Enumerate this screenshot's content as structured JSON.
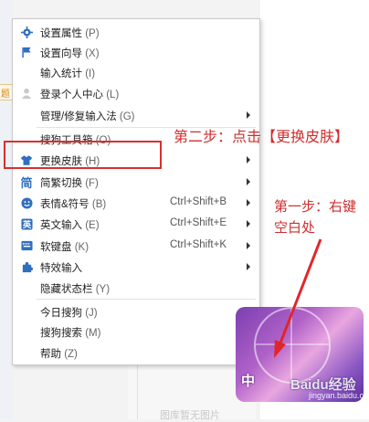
{
  "menu": {
    "items": [
      {
        "icon": "gear-icon",
        "label": "设置属性",
        "key": "(P)",
        "shortcut": "",
        "submenu": false
      },
      {
        "icon": "flag-icon",
        "label": "设置向导",
        "key": "(X)",
        "shortcut": "",
        "submenu": false
      },
      {
        "icon": "",
        "label": "输入统计",
        "key": "(I)",
        "shortcut": "",
        "submenu": false
      },
      {
        "icon": "user-icon",
        "label": "登录个人中心",
        "key": "(L)",
        "shortcut": "",
        "submenu": false
      },
      {
        "icon": "",
        "label": "管理/修复输入法",
        "key": "(G)",
        "shortcut": "",
        "submenu": true
      },
      {
        "icon": "",
        "label": "搜狗工具箱",
        "key": "(O)",
        "shortcut": "",
        "submenu": false
      },
      {
        "icon": "shirt-icon",
        "label": "更换皮肤",
        "key": "(H)",
        "shortcut": "",
        "submenu": true
      },
      {
        "icon": "simplified-icon",
        "label": "简繁切换",
        "key": "(F)",
        "shortcut": "",
        "submenu": true
      },
      {
        "icon": "smiley-icon",
        "label": "表情&符号",
        "key": "(B)",
        "shortcut": "Ctrl+Shift+B",
        "submenu": true
      },
      {
        "icon": "english-icon",
        "label": "英文输入",
        "key": "(E)",
        "shortcut": "Ctrl+Shift+E",
        "submenu": true
      },
      {
        "icon": "keyboard-icon",
        "label": "软键盘",
        "key": "(K)",
        "shortcut": "Ctrl+Shift+K",
        "submenu": true
      },
      {
        "icon": "puzzle-icon",
        "label": "特效输入",
        "key": "",
        "shortcut": "",
        "submenu": true
      },
      {
        "icon": "",
        "label": "隐藏状态栏",
        "key": "(Y)",
        "shortcut": "",
        "submenu": false
      },
      {
        "icon": "",
        "label": "今日搜狗",
        "key": "(J)",
        "shortcut": "",
        "submenu": true
      },
      {
        "icon": "",
        "label": "搜狗搜索",
        "key": "(M)",
        "shortcut": "",
        "submenu": true
      },
      {
        "icon": "",
        "label": "帮助",
        "key": "(Z)",
        "shortcut": "",
        "submenu": true
      }
    ]
  },
  "annotations": {
    "step2": "第二步：点击【更换皮肤】",
    "step1": "第一步：右键空白处"
  },
  "thumbnail": {
    "ime_char": "中",
    "watermark": "Baidu经验",
    "watermark_url": "jingyan.baidu.com"
  },
  "background": {
    "left_strip_text": "题",
    "bottom_text": "图库暂无图片"
  },
  "colors": {
    "annotation_red": "#cf2e2e",
    "highlight_red": "#d8302e",
    "icon_blue": "#2f6fc0"
  }
}
